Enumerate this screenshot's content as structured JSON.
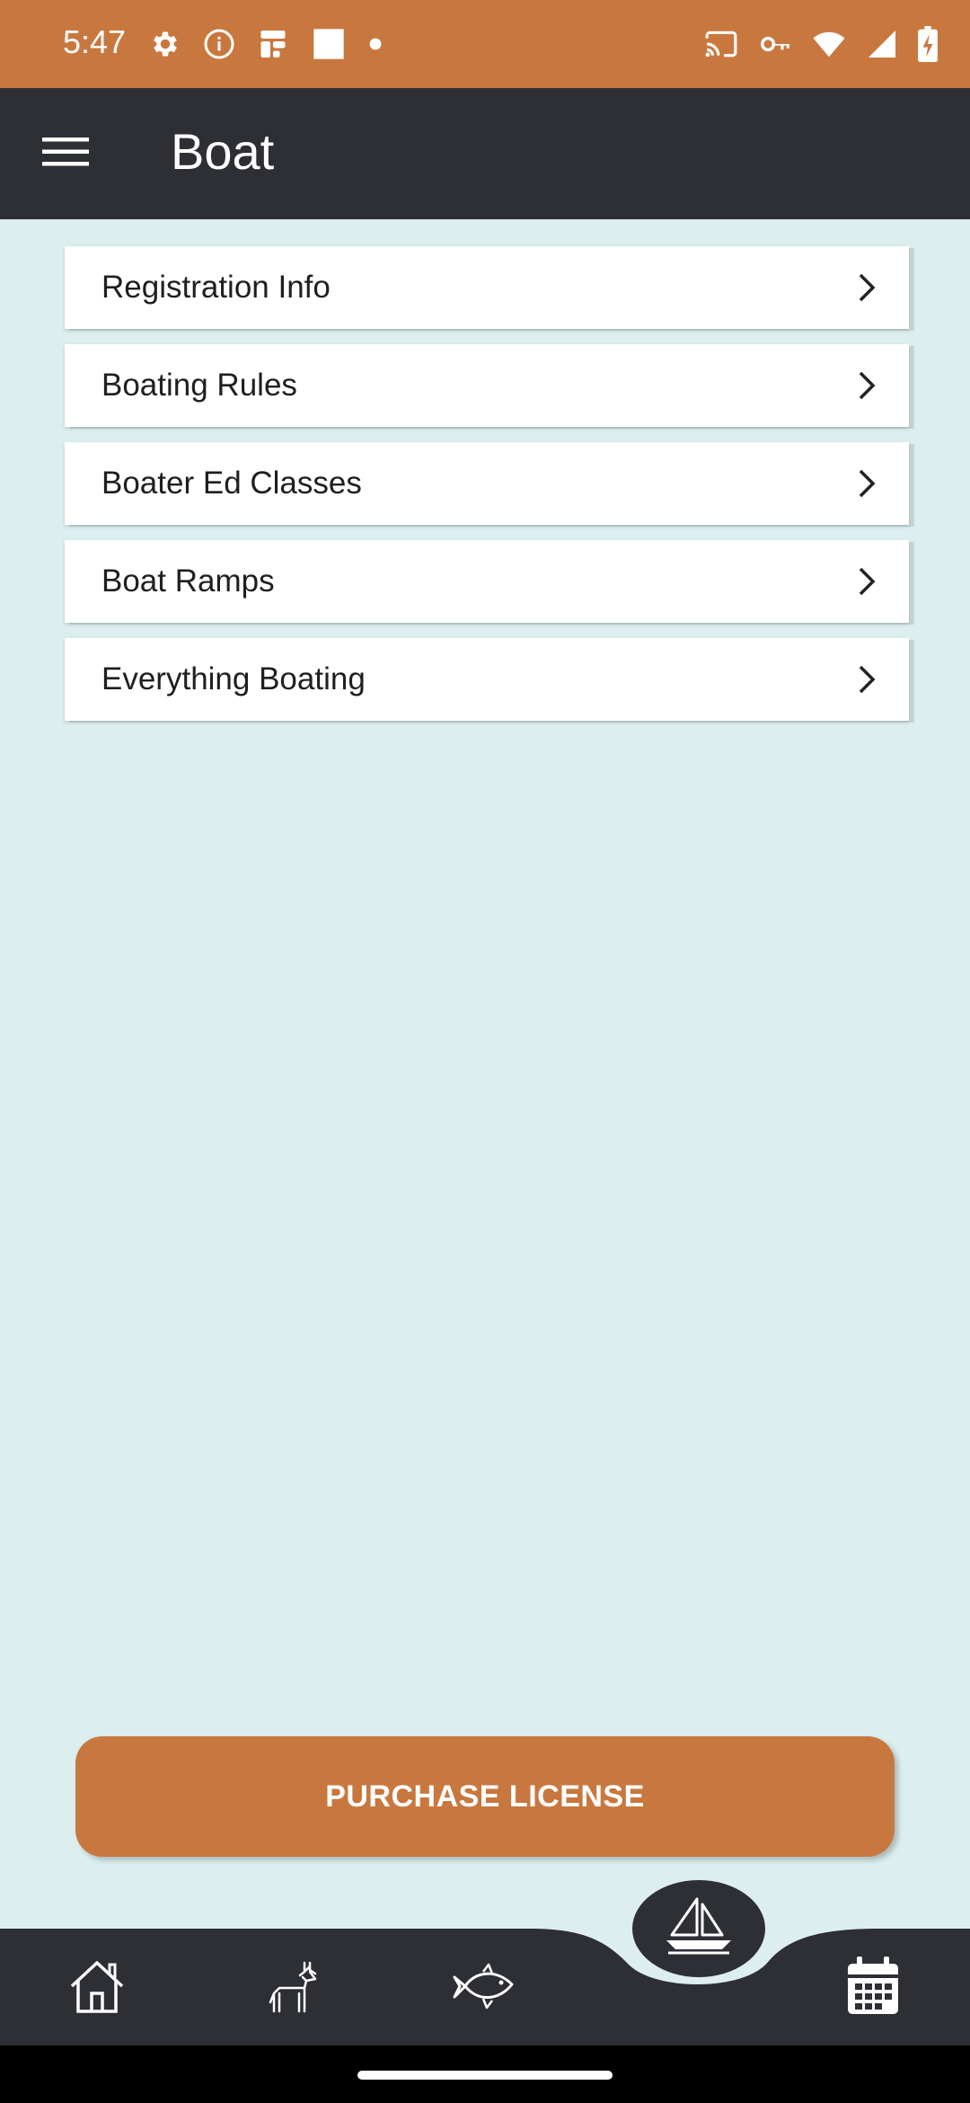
{
  "status_bar": {
    "time": "5:47",
    "left_icons": [
      "settings-icon",
      "info-icon",
      "app-notification-icon",
      "square-icon",
      "dot-icon"
    ],
    "right_icons": [
      "cast-icon",
      "vpn-key-icon",
      "wifi-icon",
      "signal-icon",
      "battery-charging-icon"
    ],
    "background": "#c8783f"
  },
  "app_bar": {
    "title": "Boat",
    "menu_icon": "hamburger-menu-icon",
    "background": "#2d2f35"
  },
  "menu_items": [
    {
      "label": "Registration Info"
    },
    {
      "label": "Boating Rules"
    },
    {
      "label": "Boater Ed Classes"
    },
    {
      "label": "Boat Ramps"
    },
    {
      "label": "Everything Boating"
    }
  ],
  "purchase_button": {
    "label": "PURCHASE LICENSE",
    "color": "#c8783f"
  },
  "bottom_nav": {
    "items": [
      {
        "name": "home",
        "icon": "home-icon"
      },
      {
        "name": "hunt",
        "icon": "deer-icon"
      },
      {
        "name": "fish",
        "icon": "fish-icon"
      },
      {
        "name": "boat",
        "icon": "sailboat-icon",
        "selected": true
      },
      {
        "name": "calendar",
        "icon": "calendar-icon"
      }
    ],
    "background": "#2d2f35"
  },
  "colors": {
    "page_background": "#dceeee",
    "accent": "#c8783f",
    "dark": "#2d2f35"
  }
}
